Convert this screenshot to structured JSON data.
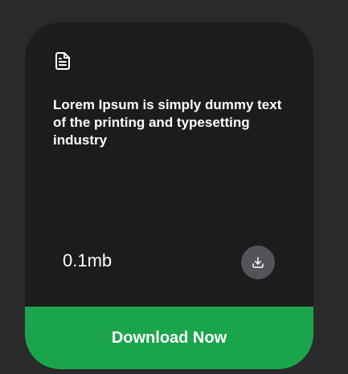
{
  "card": {
    "icon": "document-icon",
    "title": "Lorem Ipsum is simply dummy text of the printing and typesetting industry",
    "file_size": "0.1mb",
    "download_icon": "download-icon",
    "cta_label": "Download Now"
  },
  "colors": {
    "page_background": "#2a292c",
    "card_background": "#1c1c1e",
    "icon_button_background": "#535358",
    "accent_green": "#1ba54a",
    "text": "#ffffff"
  }
}
